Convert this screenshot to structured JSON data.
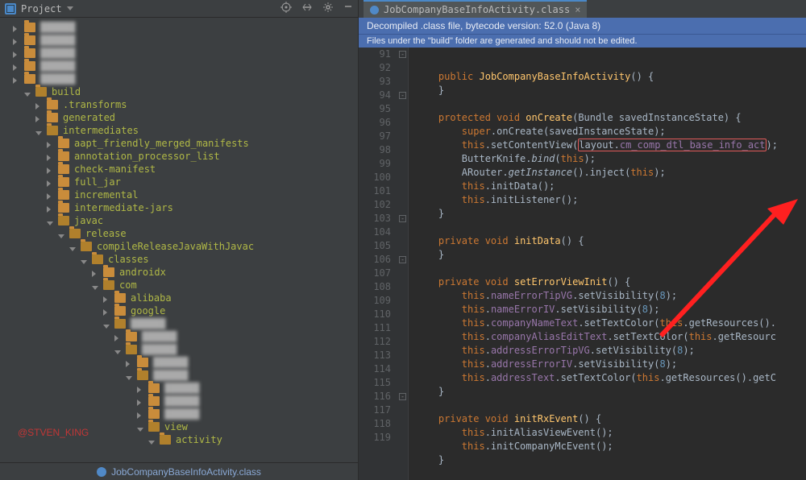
{
  "sidebar": {
    "title": "Project",
    "footerFile": "JobCompanyBaseInfoActivity.class",
    "watermark": "@STVEN_KING",
    "nodes": [
      {
        "ind": 0,
        "icon": "r",
        "lab": "",
        "cls": "blur"
      },
      {
        "ind": 0,
        "icon": "r",
        "lab": "",
        "cls": "blur"
      },
      {
        "ind": 0,
        "icon": "r",
        "lab": "",
        "cls": "blur"
      },
      {
        "ind": 0,
        "icon": "r",
        "lab": "",
        "cls": "blur"
      },
      {
        "ind": 0,
        "icon": "r",
        "lab": "",
        "cls": "blur"
      },
      {
        "ind": 1,
        "icon": "d",
        "lab": "build",
        "open": true
      },
      {
        "ind": 2,
        "icon": "r",
        "lab": ".transforms"
      },
      {
        "ind": 2,
        "icon": "r",
        "lab": "generated"
      },
      {
        "ind": 2,
        "icon": "d",
        "lab": "intermediates",
        "open": true
      },
      {
        "ind": 3,
        "icon": "r",
        "lab": "aapt_friendly_merged_manifests"
      },
      {
        "ind": 3,
        "icon": "r",
        "lab": "annotation_processor_list"
      },
      {
        "ind": 3,
        "icon": "r",
        "lab": "check-manifest"
      },
      {
        "ind": 3,
        "icon": "r",
        "lab": "full_jar"
      },
      {
        "ind": 3,
        "icon": "r",
        "lab": "incremental"
      },
      {
        "ind": 3,
        "icon": "r",
        "lab": "intermediate-jars"
      },
      {
        "ind": 3,
        "icon": "d",
        "lab": "javac",
        "open": true
      },
      {
        "ind": 4,
        "icon": "d",
        "lab": "release",
        "open": true
      },
      {
        "ind": 5,
        "icon": "d",
        "lab": "compileReleaseJavaWithJavac",
        "open": true
      },
      {
        "ind": 6,
        "icon": "d",
        "lab": "classes",
        "open": true
      },
      {
        "ind": 7,
        "icon": "r",
        "lab": "androidx"
      },
      {
        "ind": 7,
        "icon": "d",
        "lab": "com",
        "open": true
      },
      {
        "ind": 8,
        "icon": "r",
        "lab": "alibaba"
      },
      {
        "ind": 8,
        "icon": "r",
        "lab": "google"
      },
      {
        "ind": 8,
        "icon": "d",
        "lab": "",
        "cls": "blur",
        "open": true
      },
      {
        "ind": 9,
        "icon": "r",
        "lab": "",
        "cls": "blur"
      },
      {
        "ind": 9,
        "icon": "d",
        "lab": "",
        "cls": "blur",
        "open": true
      },
      {
        "ind": 10,
        "icon": "r",
        "lab": "",
        "cls": "blur"
      },
      {
        "ind": 10,
        "icon": "d",
        "lab": "",
        "cls": "blur",
        "open": true
      },
      {
        "ind": 11,
        "icon": "r",
        "lab": "",
        "cls": "blur"
      },
      {
        "ind": 11,
        "icon": "r",
        "lab": "",
        "cls": "blur"
      },
      {
        "ind": 11,
        "icon": "r",
        "lab": "",
        "cls": "blur"
      },
      {
        "ind": 11,
        "icon": "d",
        "lab": "view",
        "open": true
      },
      {
        "ind": 12,
        "icon": "d",
        "lab": "activity",
        "open": true
      }
    ]
  },
  "tab": {
    "label": "JobCompanyBaseInfoActivity.class"
  },
  "banner1": "Decompiled .class file, bytecode version: 52.0 (Java 8)",
  "banner2": "Files under the \"build\" folder are generated and should not be edited.",
  "lines": {
    "first": 91,
    "rows": [
      "    <kw>public</kw> <fn>JobCompanyBaseInfoActivity</fn>() {",
      "    }",
      "",
      "    <kw>protected void</kw> <fn>onCreate</fn>(Bundle savedInstanceState) {",
      "        <kw>super</kw>.onCreate(savedInstanceState);",
      "        <kw>this</kw>.setContentView(<boxred>layout.<pu>cm_comp_dtl_base_info_act</pu></boxred>);",
      "        ButterKnife.<i>bind</i>(<kw>this</kw>);",
      "        ARouter.<i>getInstance</i>().inject(<kw>this</kw>);",
      "        <kw>this</kw>.initData();",
      "        <kw>this</kw>.initListener();",
      "    }",
      "",
      "    <kw>private void</kw> <fn>initData</fn>() {",
      "    }",
      "",
      "    <kw>private void</kw> <fn>setErrorViewInit</fn>() {",
      "        <kw>this</kw>.<pu>nameErrorTipVG</pu>.setVisibility(<num>8</num>);",
      "        <kw>this</kw>.<pu>nameErrorIV</pu>.setVisibility(<num>8</num>);",
      "        <kw>this</kw>.<pu>companyNameText</pu>.setTextColor(<kw>this</kw>.getResources().",
      "        <kw>this</kw>.<pu>companyAliasEditText</pu>.setTextColor(<kw>this</kw>.getResourc",
      "        <kw>this</kw>.<pu>addressErrorTipVG</pu>.setVisibility(<num>8</num>);",
      "        <kw>this</kw>.<pu>addressErrorIV</pu>.setVisibility(<num>8</num>);",
      "        <kw>this</kw>.<pu>addressText</pu>.setTextColor(<kw>this</kw>.getResources().getC",
      "    }",
      "",
      "    <kw>private void</kw> <fn>initRxEvent</fn>() {",
      "        <kw>this</kw>.initAliasViewEvent();",
      "        <kw>this</kw>.initCompanyMcEvent();",
      "    }"
    ]
  }
}
